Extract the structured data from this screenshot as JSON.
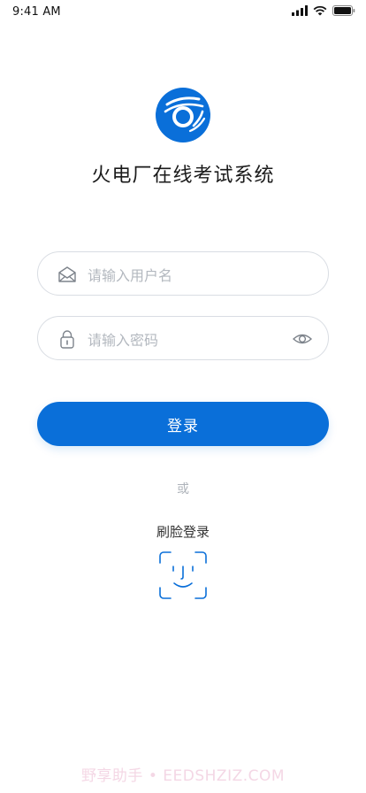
{
  "status_bar": {
    "time": "9:41 AM",
    "icons": [
      "signal-icon",
      "wifi-icon",
      "battery-icon"
    ]
  },
  "app": {
    "title": "火电厂在线考试系统",
    "brand_color": "#0a6fd9"
  },
  "form": {
    "username_placeholder": "请输入用户名",
    "username_value": "",
    "password_placeholder": "请输入密码",
    "password_value": "",
    "login_label": "登录"
  },
  "alt_login": {
    "or_label": "或",
    "face_login_label": "刷脸登录"
  },
  "watermark": "野享助手 • EEDSHZIZ.COM"
}
